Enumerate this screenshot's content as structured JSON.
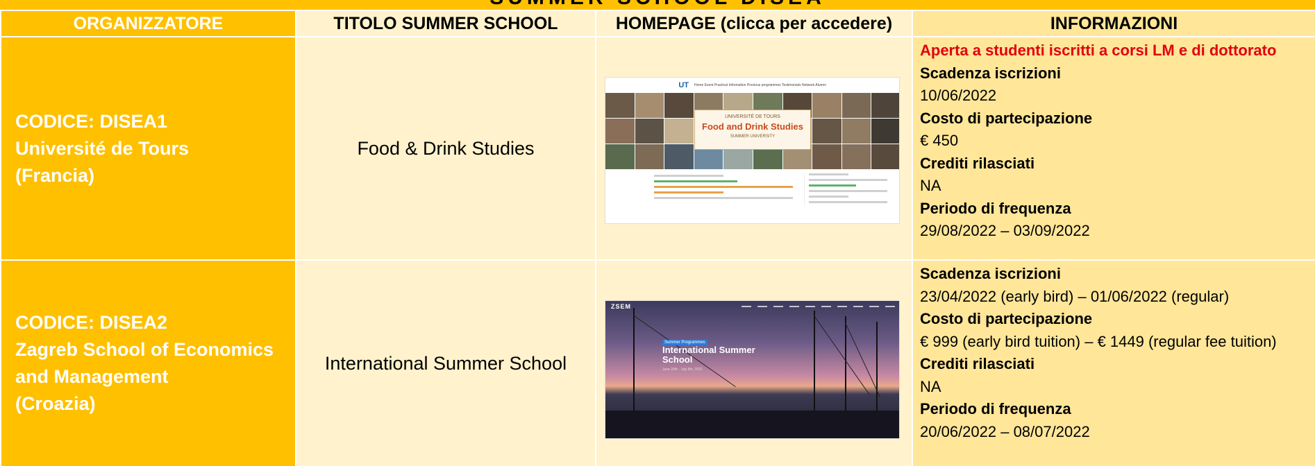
{
  "page_title_clipped": "SUMMER SCHOOL DISEA",
  "table": {
    "headers": {
      "organizer": "ORGANIZZATORE",
      "title": "TITOLO SUMMER SCHOOL",
      "homepage": "HOMEPAGE (clicca per accedere)",
      "info": "INFORMAZIONI"
    },
    "rows": [
      {
        "org_code": "CODICE: DISEA1",
        "org_name_1": "Université de Tours",
        "org_name_2": "(Francia)",
        "school_title": "Food & Drink Studies",
        "thumb": {
          "logo": "UT",
          "nav": "Home  Event  Practical Information  Previous programmes  Testimonials  Network Alumni",
          "banner_small": "UNIVERSITÉ DE TOURS",
          "banner_big": "Food and Drink Studies",
          "banner_sub": "SUMMER UNIVERSITY"
        },
        "info": {
          "note": "Aperta a studenti iscritti a corsi LM e di dottorato",
          "deadline_label": "Scadenza iscrizioni",
          "deadline": "10/06/2022",
          "cost_label": "Costo di partecipazione",
          "cost": "€ 450",
          "credits_label": "Crediti rilasciati",
          "credits": "NA",
          "period_label": "Periodo di frequenza",
          "period": "29/08/2022 – 03/09/2022"
        }
      },
      {
        "org_code": "CODICE: DISEA2",
        "org_name_1": "Zagreb School of Economics",
        "org_name_2": "and Management",
        "org_name_3": "(Croazia)",
        "school_title": "International Summer School",
        "thumb": {
          "logo": "ZSEM",
          "tag": "Summer Programmes",
          "title": "International Summer School",
          "date": "June 20th - July 8th, 2022"
        },
        "info": {
          "deadline_label": "Scadenza iscrizioni",
          "deadline": "23/04/2022 (early bird) – 01/06/2022 (regular)",
          "cost_label": "Costo di partecipazione",
          "cost": "€ 999 (early bird tuition) – € 1449 (regular fee tuition)",
          "credits_label": "Crediti rilasciati",
          "credits": "NA",
          "period_label": "Periodo di frequenza",
          "period": "20/06/2022 – 08/07/2022"
        }
      }
    ]
  },
  "colors": {
    "orange": "#ffc000",
    "light_cream": "#fff2cc",
    "light_yellow": "#ffe699",
    "red_note": "#e3000f"
  }
}
